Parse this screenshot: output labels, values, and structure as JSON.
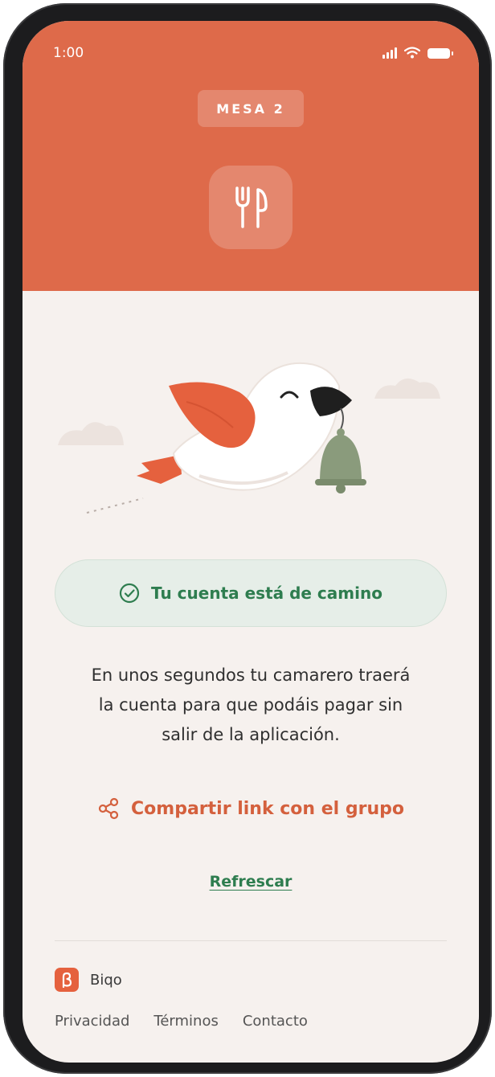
{
  "status_bar": {
    "time": "1:00"
  },
  "header": {
    "table_label": "MESA 2",
    "restaurant_icon": "fork-knife-icon"
  },
  "illustration": {
    "icon": "bird-carrying-bell-illustration"
  },
  "status": {
    "icon": "check-circle-icon",
    "text": "Tu cuenta está de camino"
  },
  "description_lines": [
    "En unos segundos tu camarero traerá",
    "la cuenta para que podáis pagar sin",
    "salir de la aplicación."
  ],
  "share": {
    "icon": "share-icon",
    "label": "Compartir link con el grupo"
  },
  "refresh": {
    "label": "Refrescar"
  },
  "footer": {
    "brand_name": "Biqo",
    "links": [
      "Privacidad",
      "Términos",
      "Contacto"
    ]
  },
  "colors": {
    "brand": "#de6a4a",
    "success": "#2e7d4f",
    "background": "#f6f1ee"
  }
}
